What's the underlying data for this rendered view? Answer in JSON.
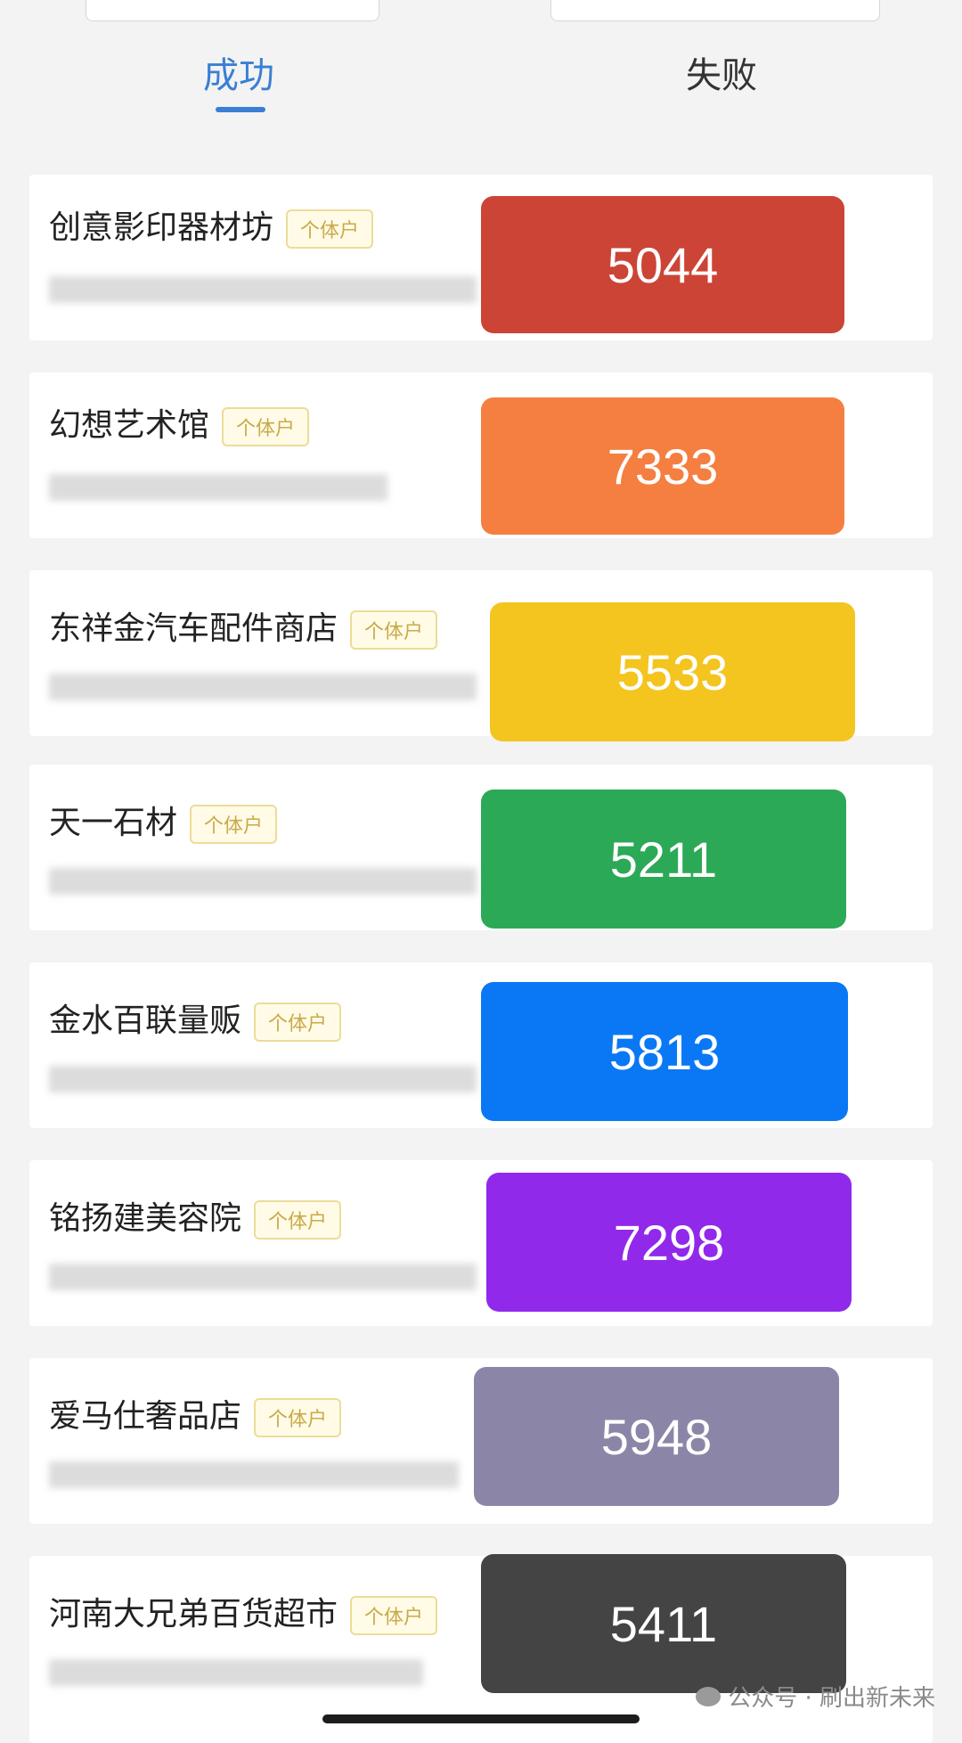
{
  "tabs": {
    "success": "成功",
    "fail": "失败"
  },
  "badge_label": "个体户",
  "shops": [
    {
      "name": "创意影印器材坊",
      "value": "5044",
      "color": "#cc4436"
    },
    {
      "name": "幻想艺术馆",
      "value": "7333",
      "color": "#f57f40"
    },
    {
      "name": "东祥金汽车配件商店",
      "value": "5533",
      "color": "#f4c41f"
    },
    {
      "name": "天一石材",
      "value": "5211",
      "color": "#2ca957"
    },
    {
      "name": "金水百联量贩",
      "value": "5813",
      "color": "#0a78f5"
    },
    {
      "name": "铭扬建美容院",
      "value": "7298",
      "color": "#9129eb"
    },
    {
      "name": "爱马仕奢品店",
      "value": "5948",
      "color": "#8b86a8"
    },
    {
      "name": "河南大兄弟百货超市",
      "value": "5411",
      "color": "#444444"
    }
  ],
  "watermark": "公众号 · 刷出新未来"
}
